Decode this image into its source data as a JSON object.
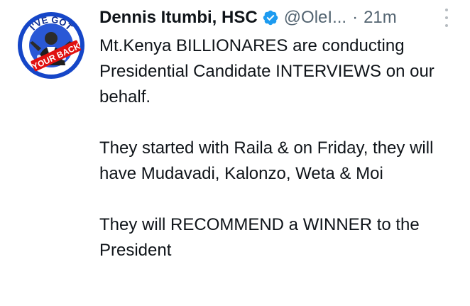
{
  "tweet": {
    "author_name": "Dennis Itumbi, HSC",
    "handle": "@OleI...",
    "separator": "·",
    "time": "21m",
    "avatar_text": "I'VE GOT YOUR BACK",
    "paragraphs": [
      "Mt.Kenya BILLIONARES are conducting Presidential Candidate INTERVIEWS on our behalf.",
      "They started with Raila & on Friday, they will have Mudavadi, Kalonzo, Weta & Moi",
      "They will RECOMMEND a WINNER to the President"
    ],
    "icons": {
      "verified": "verified-badge-icon",
      "more": "more-options-icon"
    },
    "colors": {
      "verified": "#1d9bf0",
      "secondary_text": "#536471",
      "avatar_ring": "#1546c8"
    }
  }
}
